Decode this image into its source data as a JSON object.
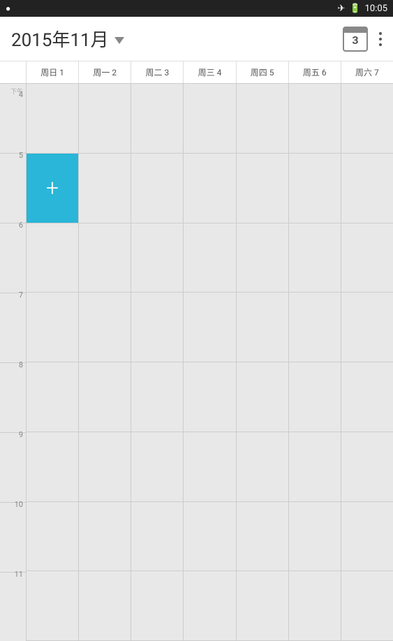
{
  "statusBar": {
    "leftIcon": "wifi-icon",
    "rightIcons": [
      "airplane-icon",
      "battery-icon"
    ],
    "time": "10:05"
  },
  "header": {
    "title": "2015年11月",
    "calendarDayNumber": "3",
    "moreButtonLabel": "⋮",
    "dropdownArrow": true
  },
  "dowLabels": [
    "周日 1",
    "周一 2",
    "周二 3",
    "周三 4",
    "周四 5",
    "周五 6",
    "周六 7"
  ],
  "timeSlots": [
    {
      "label": "4",
      "sub": "下午"
    },
    {
      "label": "5",
      "sub": ""
    },
    {
      "label": "6",
      "sub": ""
    },
    {
      "label": "7",
      "sub": ""
    },
    {
      "label": "8",
      "sub": ""
    },
    {
      "label": "9",
      "sub": ""
    },
    {
      "label": "10",
      "sub": ""
    },
    {
      "label": "11",
      "sub": ""
    }
  ],
  "addEventSymbol": "+",
  "colors": {
    "addEventBg": "#29b6d8",
    "gridBg": "#e8e8e8",
    "headerBg": "#ffffff"
  }
}
